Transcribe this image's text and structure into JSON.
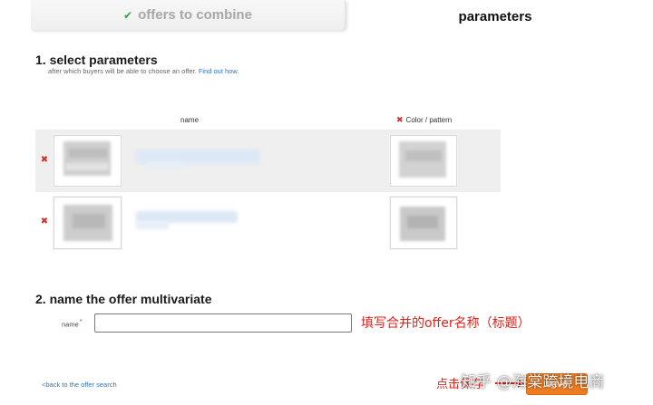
{
  "tabs": {
    "offers": "offers to combine",
    "parameters": "parameters"
  },
  "section1": {
    "title": "1. select parameters",
    "subtitle": "after which buyers will be able to choose an offer.",
    "find_out": "Find out how."
  },
  "table": {
    "col_name": "name",
    "col_color": "Color / pattern",
    "rows": [
      {
        "remove": "✖"
      },
      {
        "remove": "✖"
      }
    ]
  },
  "section2": {
    "title": "2. name the offer multivariate",
    "name_label": "name",
    "required_mark": "*",
    "name_value": ""
  },
  "annotations": {
    "fill_name": "填写合并的offer名称（标题）",
    "click_save": "点击保存"
  },
  "footer": {
    "back_link": "<back to the offer search",
    "save_label": "save"
  },
  "watermark": "知乎 @海棠跨境电商",
  "colors": {
    "accent_orange": "#f07c20",
    "link_blue": "#2e72c5",
    "remove_red": "#d0312d",
    "annotation_red": "#e0221b",
    "check_green": "#3aa142"
  },
  "icons": {
    "tab_done": "check-icon",
    "remove": "remove-x-icon",
    "arrow": "arrow-right-icon"
  }
}
